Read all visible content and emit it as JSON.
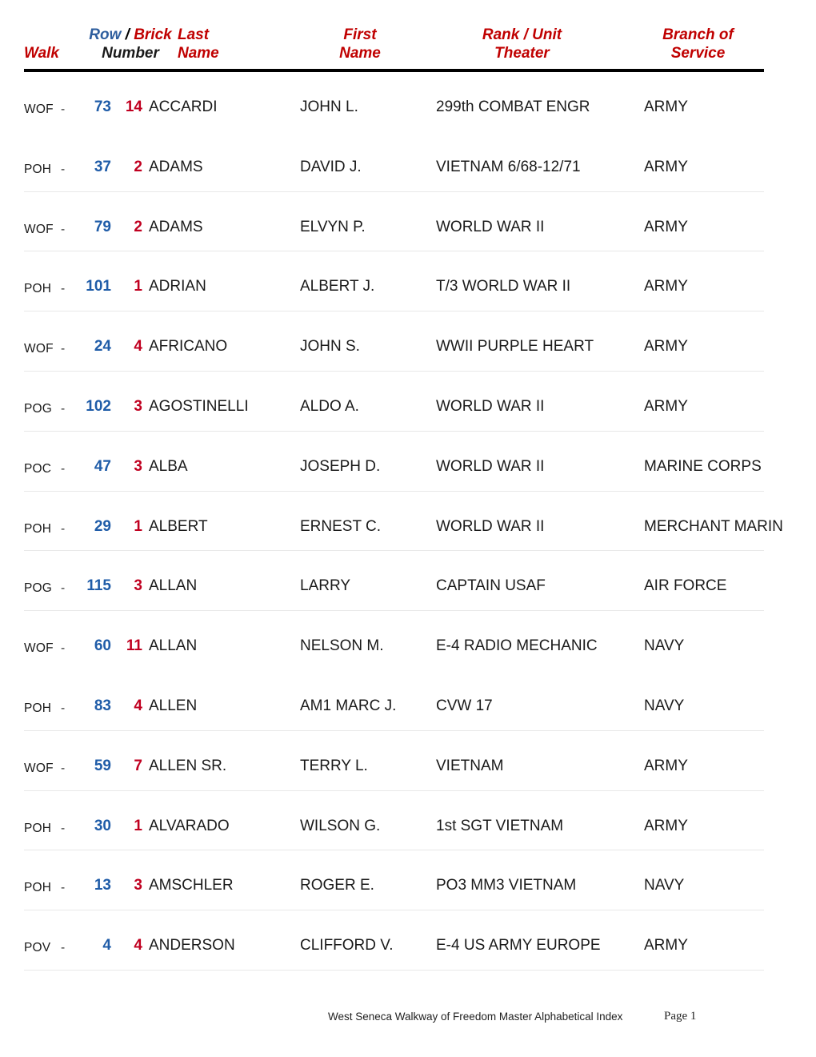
{
  "header": {
    "walk": "Walk",
    "row": "Row",
    "slash": "/",
    "brick": "Brick",
    "number": "Number",
    "last": "Last",
    "last2": "Name",
    "first": "First",
    "first2": "Name",
    "rank": "Rank / Unit",
    "rank2": "Theater",
    "branch": "Branch of",
    "branch2": "Service"
  },
  "colors": {
    "header_red": "#C00000",
    "header_blue": "#2E5E9E",
    "row_number_blue": "#1F5CA8",
    "brick_number_red": "#C00020",
    "rule_black": "#000000",
    "separator_gray": "#E8E8E8"
  },
  "rows": [
    {
      "walk": "WOF",
      "dash": "-",
      "row": "73",
      "brick": "14",
      "last": "ACCARDI",
      "first": "JOHN L.",
      "rank": "299th COMBAT ENGR",
      "branch": "ARMY",
      "sep": false
    },
    {
      "walk": "POH",
      "dash": "-",
      "row": "37",
      "brick": "2",
      "last": "ADAMS",
      "first": "DAVID J.",
      "rank": "VIETNAM 6/68-12/71",
      "branch": "ARMY",
      "sep": true
    },
    {
      "walk": "WOF",
      "dash": "-",
      "row": "79",
      "brick": "2",
      "last": "ADAMS",
      "first": "ELVYN P.",
      "rank": "WORLD WAR II",
      "branch": "ARMY",
      "sep": true
    },
    {
      "walk": "POH",
      "dash": "-",
      "row": "101",
      "brick": "1",
      "last": "ADRIAN",
      "first": "ALBERT J.",
      "rank": "T/3 WORLD WAR II",
      "branch": "ARMY",
      "sep": true
    },
    {
      "walk": "WOF",
      "dash": "-",
      "row": "24",
      "brick": "4",
      "last": "AFRICANO",
      "first": "JOHN S.",
      "rank": "WWII PURPLE HEART",
      "branch": "ARMY",
      "sep": true
    },
    {
      "walk": "POG",
      "dash": "-",
      "row": "102",
      "brick": "3",
      "last": "AGOSTINELLI",
      "first": "ALDO A.",
      "rank": "WORLD WAR II",
      "branch": "ARMY",
      "sep": true
    },
    {
      "walk": "POC",
      "dash": "-",
      "row": "47",
      "brick": "3",
      "last": "ALBA",
      "first": "JOSEPH D.",
      "rank": "WORLD WAR II",
      "branch": "MARINE CORPS",
      "sep": true
    },
    {
      "walk": "POH",
      "dash": "-",
      "row": "29",
      "brick": "1",
      "last": "ALBERT",
      "first": "ERNEST C.",
      "rank": "WORLD WAR II",
      "branch": "MERCHANT MARIN",
      "sep": true
    },
    {
      "walk": "POG",
      "dash": "-",
      "row": "115",
      "brick": "3",
      "last": "ALLAN",
      "first": "LARRY",
      "rank": "CAPTAIN USAF",
      "branch": "AIR FORCE",
      "sep": true
    },
    {
      "walk": "WOF",
      "dash": "-",
      "row": "60",
      "brick": "11",
      "last": "ALLAN",
      "first": "NELSON M.",
      "rank": "E-4 RADIO MECHANIC",
      "branch": "NAVY",
      "sep": false
    },
    {
      "walk": "POH",
      "dash": "-",
      "row": "83",
      "brick": "4",
      "last": "ALLEN",
      "first": "AM1 MARC J.",
      "rank": "CVW 17",
      "branch": "NAVY",
      "sep": true
    },
    {
      "walk": "WOF",
      "dash": "-",
      "row": "59",
      "brick": "7",
      "last": "ALLEN SR.",
      "first": "TERRY L.",
      "rank": "VIETNAM",
      "branch": "ARMY",
      "sep": true
    },
    {
      "walk": "POH",
      "dash": "-",
      "row": "30",
      "brick": "1",
      "last": "ALVARADO",
      "first": "WILSON G.",
      "rank": "1st SGT  VIETNAM",
      "branch": "ARMY",
      "sep": true
    },
    {
      "walk": "POH",
      "dash": "-",
      "row": "13",
      "brick": "3",
      "last": "AMSCHLER",
      "first": "ROGER E.",
      "rank": "PO3 MM3  VIETNAM",
      "branch": "NAVY",
      "sep": true
    },
    {
      "walk": "POV",
      "dash": "-",
      "row": "4",
      "brick": "4",
      "last": "ANDERSON",
      "first": "CLIFFORD V.",
      "rank": "E-4 US ARMY EUROPE",
      "branch": "ARMY",
      "sep": true
    }
  ],
  "footer": {
    "title": "West Seneca Walkway of Freedom Master Alphabetical Index",
    "page": "Page 1"
  }
}
